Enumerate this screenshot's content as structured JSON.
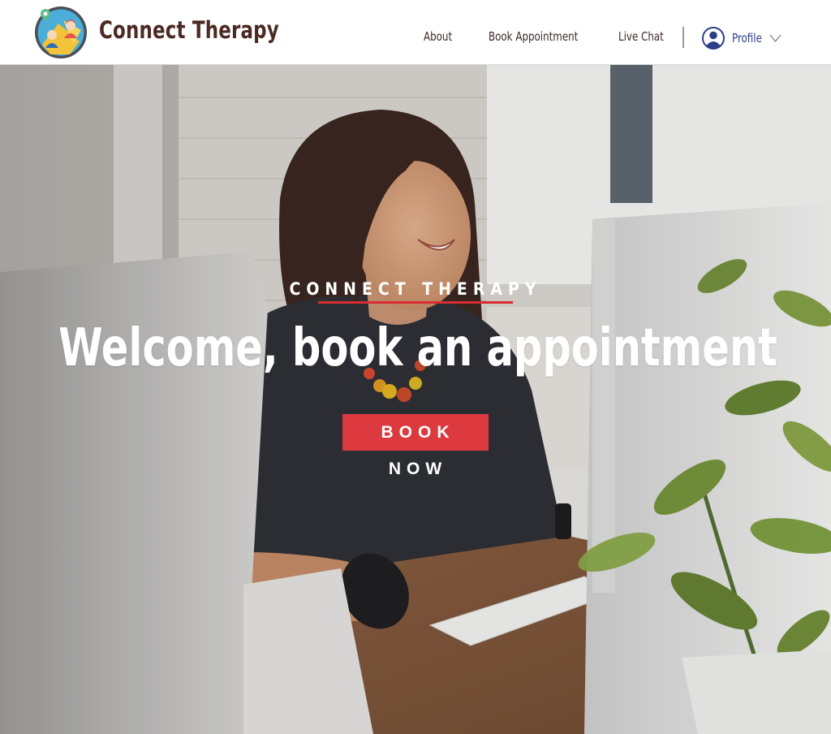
{
  "header": {
    "brand": "Connect Therapy",
    "nav": {
      "about": "About",
      "book": "Book Appointment",
      "chat": "Live Chat",
      "profile": "Profile"
    }
  },
  "hero": {
    "eyebrow": "CONNECT THERAPY",
    "headline": "Welcome, book an appointment",
    "cta": "BOOK NOW"
  },
  "colors": {
    "brand_text": "#4a2a22",
    "accent_red": "#dc3a3e",
    "profile_blue": "#2c3e88"
  },
  "icons": [
    "logo-icon",
    "profile-icon",
    "chevron-down-icon"
  ]
}
